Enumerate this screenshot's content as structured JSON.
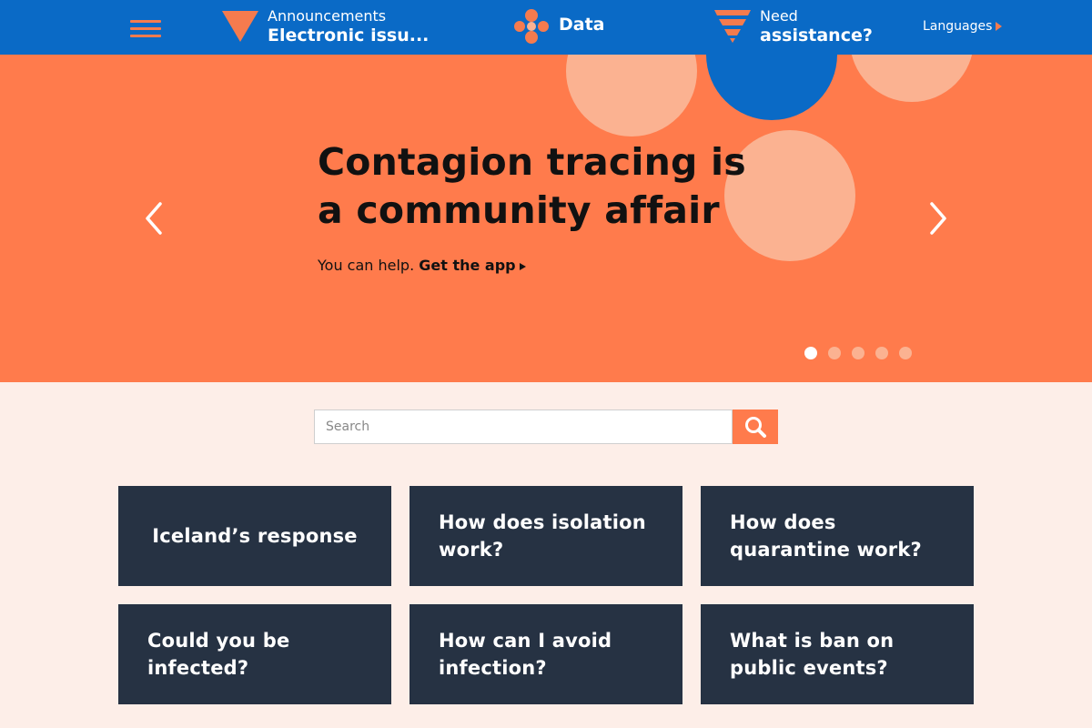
{
  "header": {
    "announcements_small": "Announcements",
    "announcements_big": "Electronic issu...",
    "data_label": "Data",
    "help_small": "Need",
    "help_big": "assistance?",
    "languages": "Languages"
  },
  "hero": {
    "title": "Contagion tracing is a community affair",
    "subtitle_text": "You can help.",
    "subtitle_link": "Get the app",
    "slide_count": 5,
    "active_slide": 1
  },
  "search": {
    "placeholder": "Search"
  },
  "cards": [
    "Iceland’s response",
    "How does isolation work?",
    "How does quarantine work?",
    "Could you be infected?",
    "How can I avoid infection?",
    "What is ban on public events?"
  ],
  "colors": {
    "header_blue": "#0a6ac6",
    "accent_orange": "#ff7b4c",
    "light_orange": "#fbb291",
    "card_navy": "#263243",
    "page_bg": "#fdeee8"
  }
}
